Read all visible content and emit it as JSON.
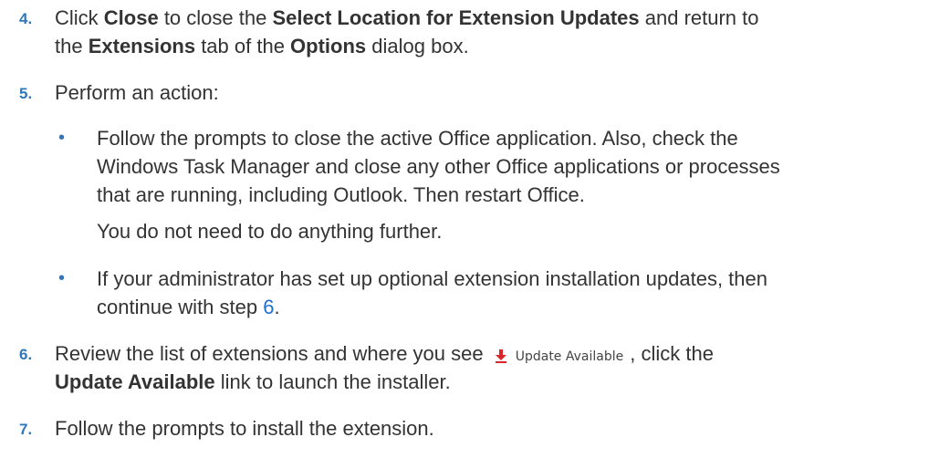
{
  "steps": {
    "s4": {
      "number": "4.",
      "t1": "Click ",
      "b1": "Close",
      "t2": " to close the ",
      "b2": "Select Location for Extension Updates",
      "t3": " and return to",
      "t4": "the ",
      "b3": "Extensions",
      "t5": " tab of the ",
      "b4": "Options",
      "t6": " dialog box."
    },
    "s5": {
      "number": "5.",
      "text": "Perform an action:",
      "bullet1": {
        "line1": "Follow the prompts to close the active Office application. Also, check the",
        "line2": "Windows Task Manager and close any other Office applications or processes",
        "line3": "that are running, including Outlook. Then restart Office.",
        "note": "You do not need to do anything further."
      },
      "bullet2": {
        "line1": "If your administrator has set up optional extension installation updates, then",
        "line2a": "continue with step ",
        "link": "6",
        "line2b": "."
      }
    },
    "s6": {
      "number": "6.",
      "t1": "Review the list of extensions and where you see ",
      "image_label": "Update Available",
      "t2": ", click the",
      "b1": "Update Available",
      "t3": " link to launch the installer."
    },
    "s7": {
      "number": "7.",
      "text": "Follow the prompts to install the extension."
    }
  },
  "colors": {
    "step_number": "#2f77b9",
    "link": "#1f6fd1",
    "body_text": "#333333",
    "arrow_icon": "#d9262b"
  },
  "icons": {
    "update_icon": "download-arrow-icon",
    "bullet": "bullet-icon"
  }
}
